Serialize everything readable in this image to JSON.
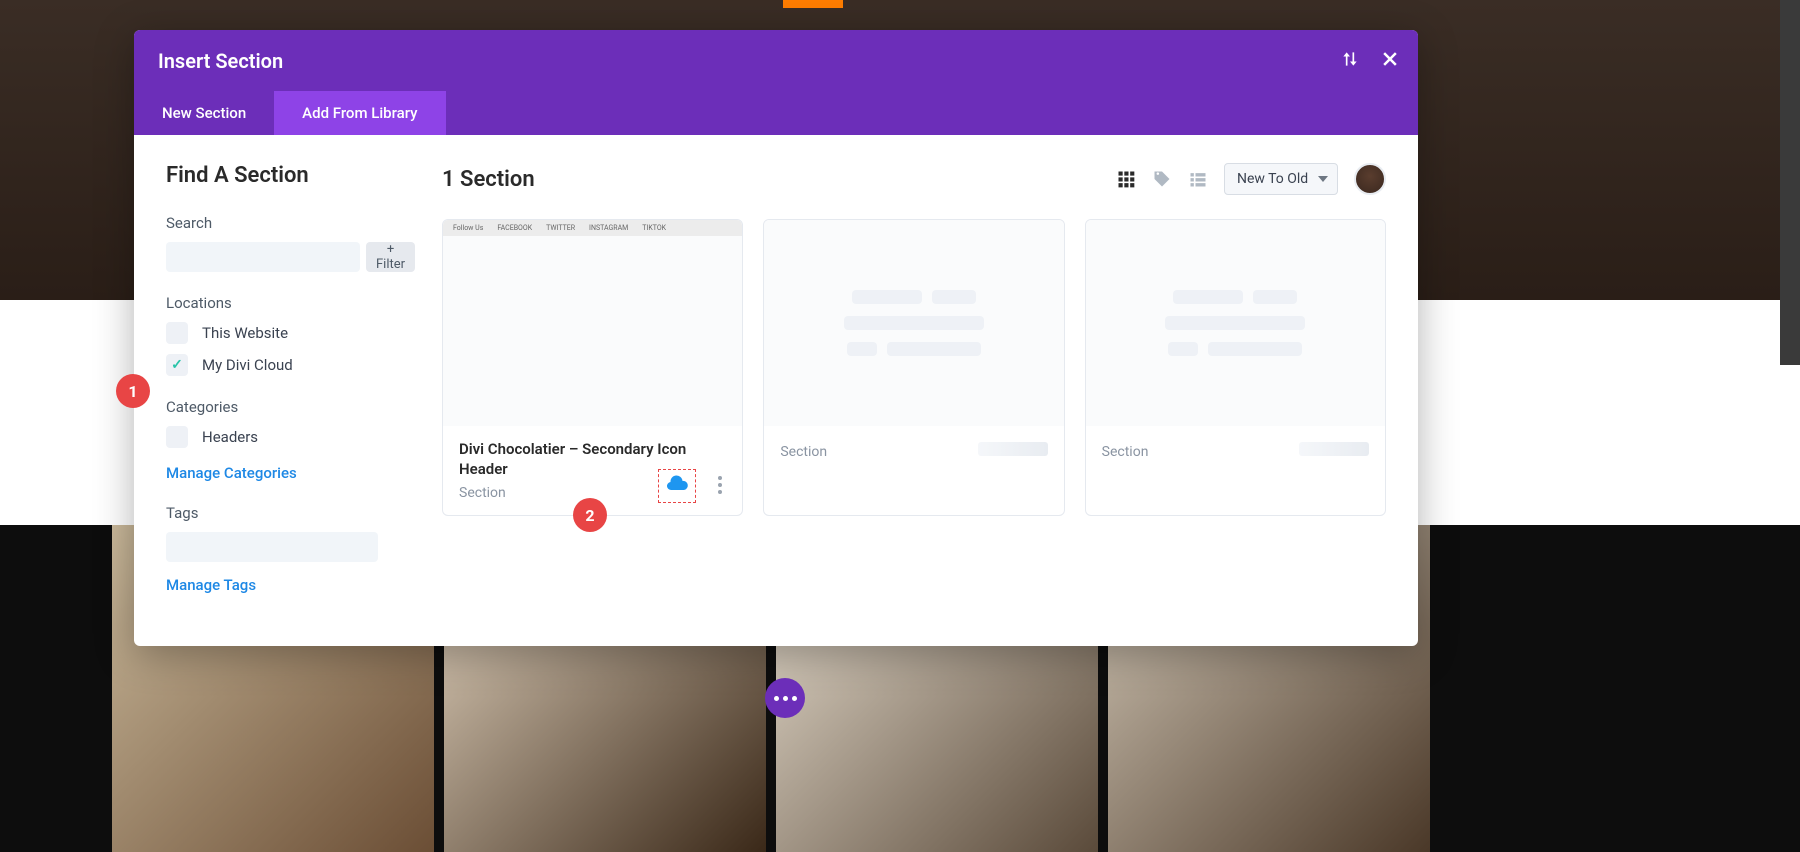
{
  "modal": {
    "title": "Insert Section",
    "tabs": {
      "new_section": "New Section",
      "add_from_library": "Add From Library"
    }
  },
  "sidebar": {
    "title": "Find A Section",
    "search_label": "Search",
    "filter_label": "+ Filter",
    "locations_label": "Locations",
    "locations": [
      {
        "label": "This Website",
        "checked": false
      },
      {
        "label": "My Divi Cloud",
        "checked": true
      }
    ],
    "categories_label": "Categories",
    "categories": [
      {
        "label": "Headers",
        "checked": false
      }
    ],
    "manage_categories": "Manage Categories",
    "tags_label": "Tags",
    "manage_tags": "Manage Tags"
  },
  "content": {
    "title": "1 Section",
    "sort": "New To Old",
    "cards": [
      {
        "title": "Divi Chocolatier – Secondary Icon Header",
        "subtitle": "Section",
        "preview_social": [
          "Follow Us",
          "FACEBOOK",
          "TWITTER",
          "INSTAGRAM",
          "TIKTOK"
        ]
      }
    ],
    "placeholder_subtitle": "Section"
  },
  "annotations": {
    "one": "1",
    "two": "2"
  }
}
